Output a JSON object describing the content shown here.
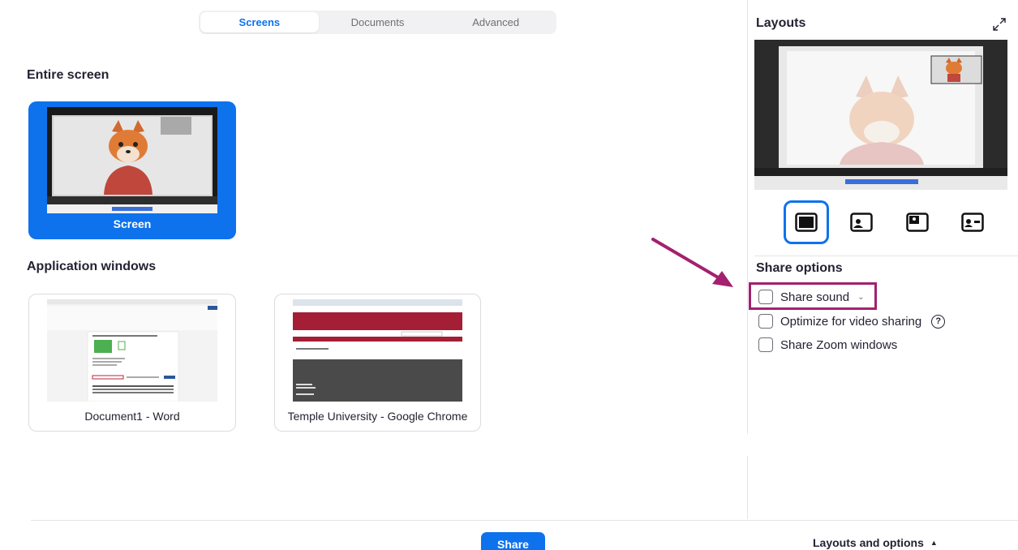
{
  "tabs": [
    {
      "label": "Screens",
      "active": true
    },
    {
      "label": "Documents",
      "active": false
    },
    {
      "label": "Advanced",
      "active": false
    }
  ],
  "entire_screen": {
    "title": "Entire screen",
    "items": [
      {
        "label": "Screen",
        "selected": true
      }
    ]
  },
  "app_windows": {
    "title": "Application windows",
    "items": [
      {
        "label": "Document1 - Word"
      },
      {
        "label": "Temple University - Google Chrome"
      }
    ]
  },
  "layouts": {
    "title": "Layouts",
    "expand_icon": "expand-icon",
    "options": [
      "screen-only",
      "speaker-left",
      "speaker-top-left",
      "speaker-side"
    ]
  },
  "share_options": {
    "title": "Share options",
    "items": [
      {
        "label": "Share sound",
        "checked": false,
        "has_dropdown": true
      },
      {
        "label": "Optimize for video sharing",
        "checked": false,
        "help_glyph": "?"
      },
      {
        "label": "Share Zoom windows",
        "checked": false
      }
    ]
  },
  "footer": {
    "share_label": "Share",
    "layouts_options_label": "Layouts and options",
    "caret_glyph": "▲"
  },
  "colors": {
    "accent": "#0e72ed",
    "highlight": "#a3216e"
  }
}
